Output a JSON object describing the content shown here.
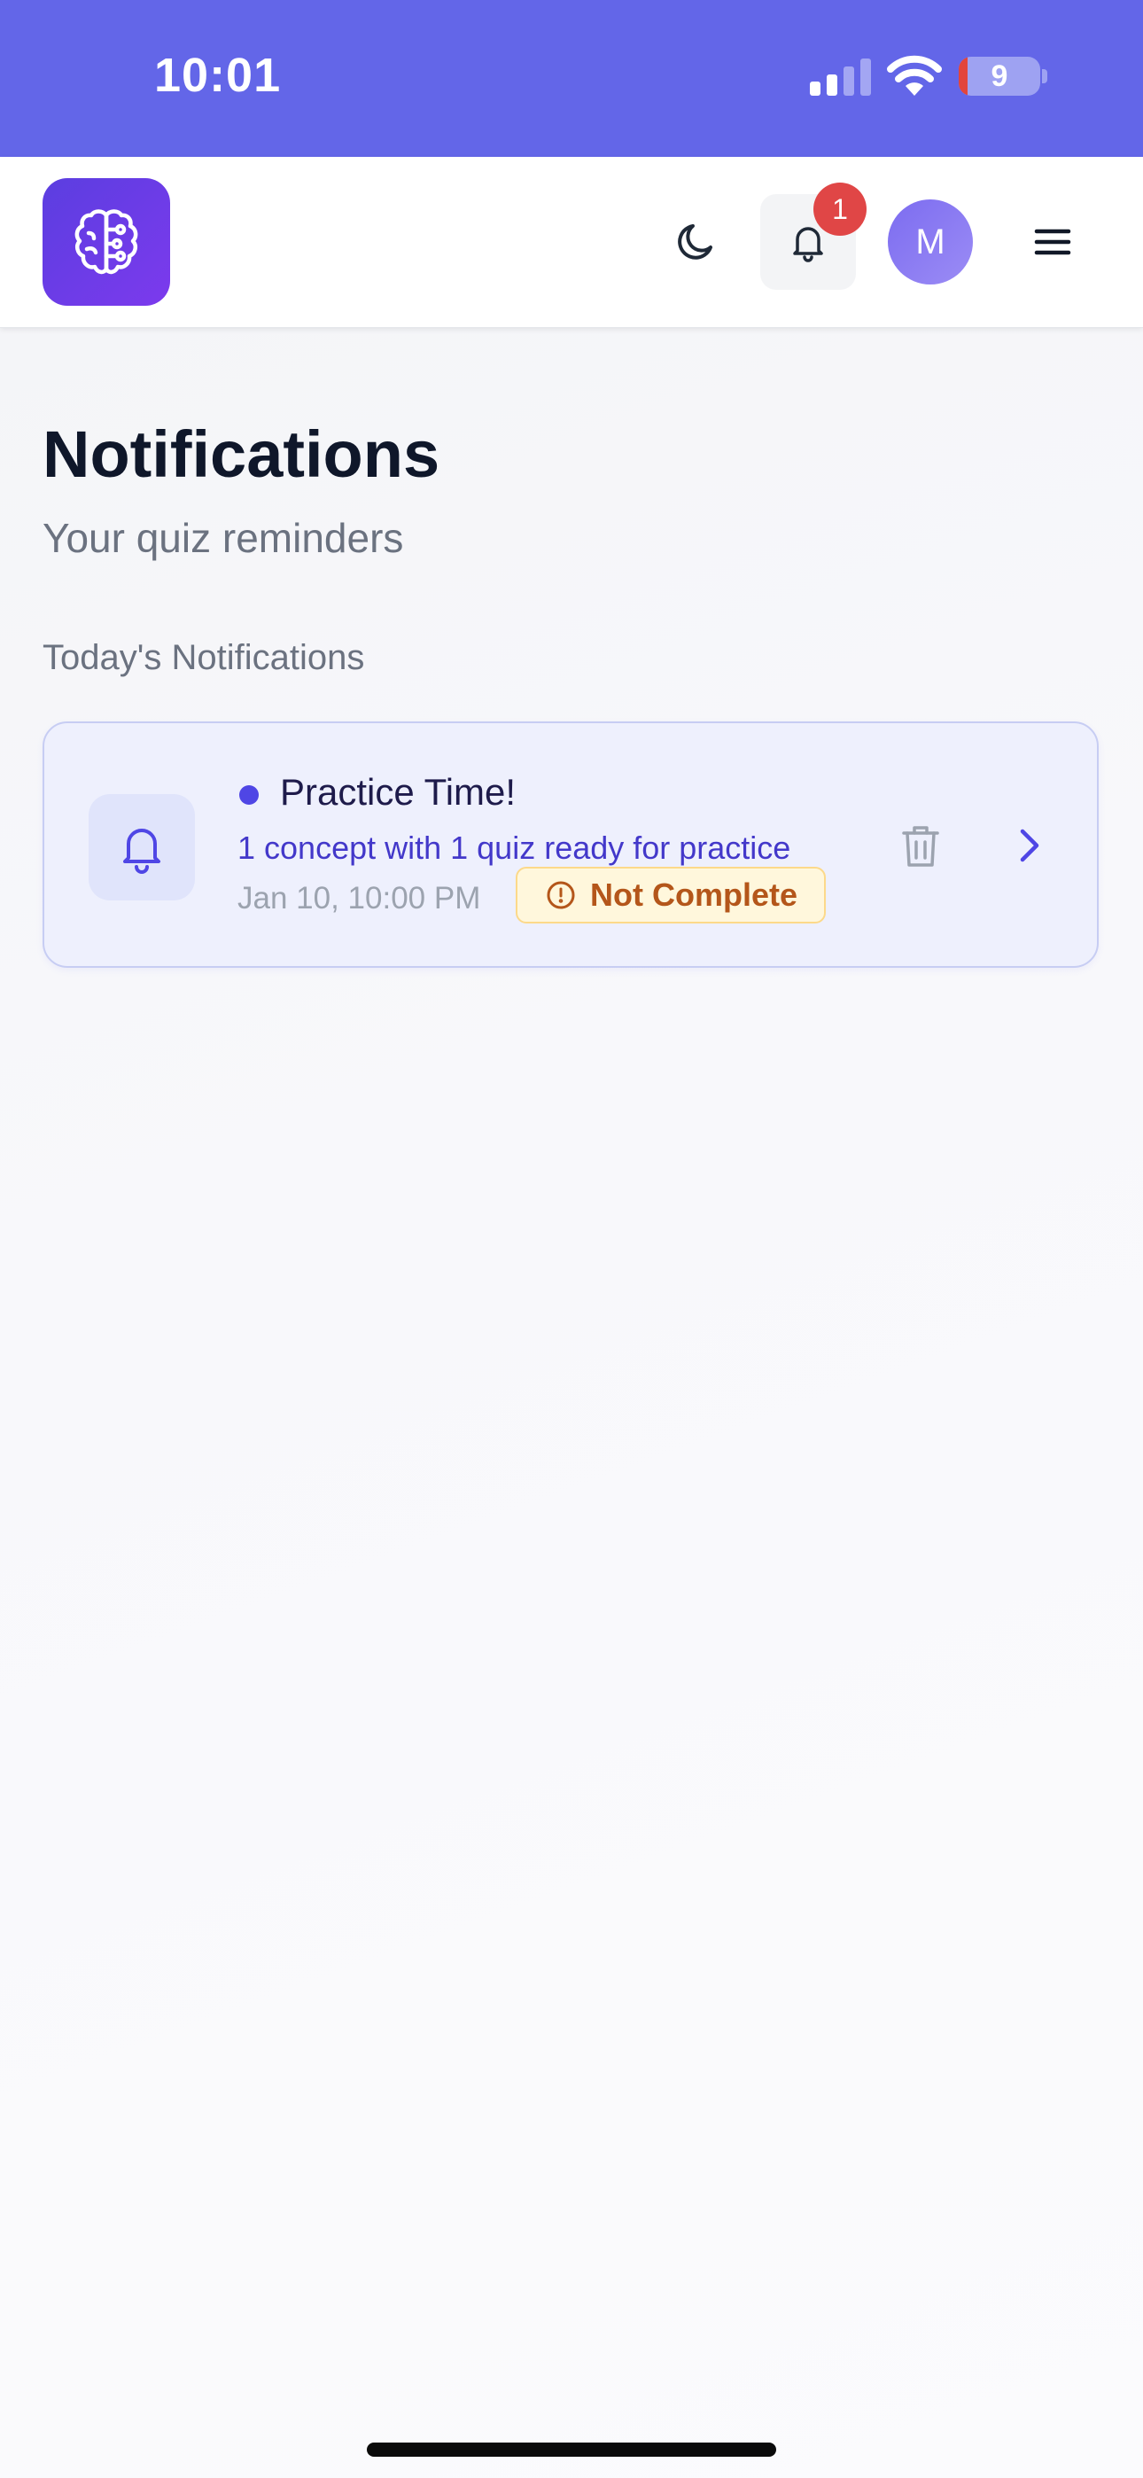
{
  "status_bar": {
    "time": "10:01",
    "battery_level": "9",
    "background_color": "#6366e8"
  },
  "header": {
    "logo_icon": "brain-circuit-icon",
    "theme_icon": "moon-icon",
    "notification_icon": "bell-icon",
    "notification_count": "1",
    "avatar_initial": "M",
    "menu_icon": "hamburger-menu-icon"
  },
  "page": {
    "title": "Notifications",
    "subtitle": "Your quiz reminders",
    "section_label": "Today's Notifications"
  },
  "notifications": [
    {
      "icon": "bell-icon",
      "unread": true,
      "title": "Practice Time!",
      "message": "1 concept with 1 quiz ready for practice",
      "time": "Jan 10, 10:00 PM",
      "status_icon": "alert-circle-icon",
      "status": "Not Complete",
      "delete_icon": "trash-icon",
      "open_icon": "chevron-right-icon"
    }
  ],
  "colors": {
    "accent": "#4f46e5",
    "card_background": "#eef0fd",
    "status_pill_text": "#b4561a",
    "badge": "#e04646"
  }
}
